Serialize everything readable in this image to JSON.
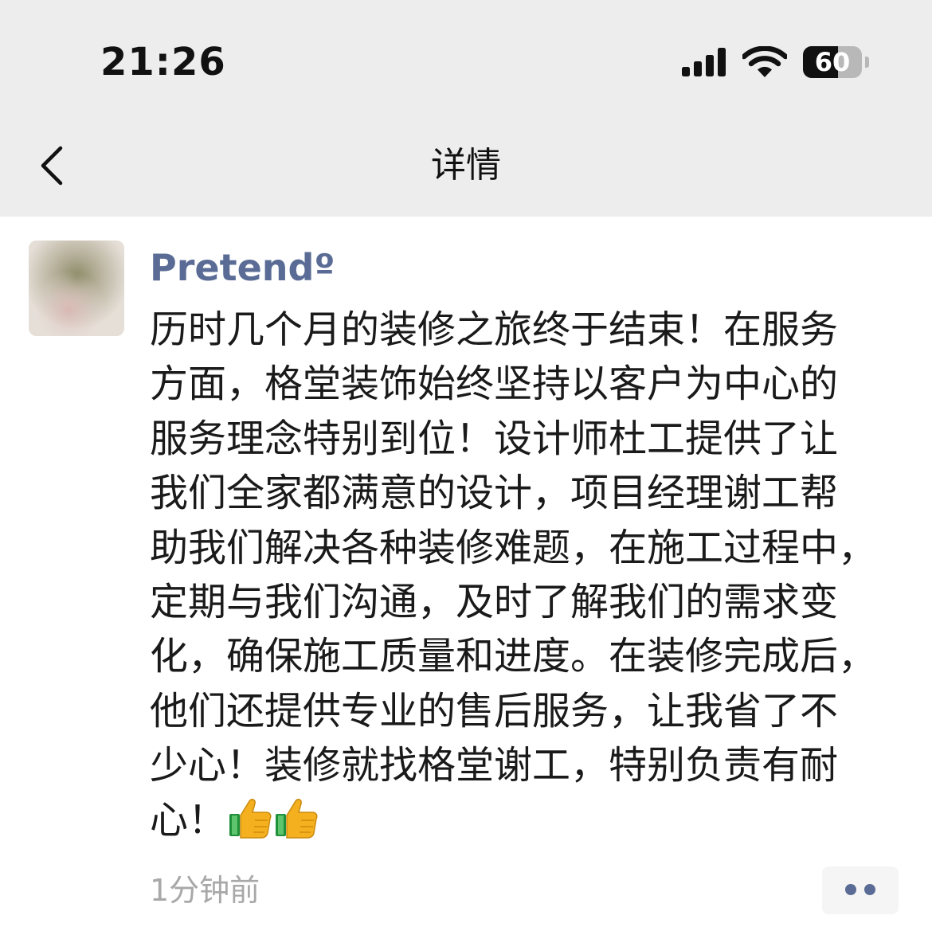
{
  "status_bar": {
    "time": "21:26",
    "battery_level": "60",
    "battery_fraction": 0.6,
    "signal_icon": "cellular-signal-icon",
    "wifi_icon": "wifi-icon"
  },
  "nav": {
    "title": "详情",
    "back_icon": "chevron-left-icon"
  },
  "post": {
    "username": "Pretendº",
    "lines": [
      "历时几个月的装修之旅终于结束！在服务",
      "方面，格堂装饰始终坚持以客户为中心的",
      "服务理念特别到位！设计师杜工提供了让",
      "我们全家都满意的设计，项目经理谢工帮",
      "助我们解决各种装修难题，在施工过程中，",
      "定期与我们沟通，及时了解我们的需求变",
      "化，确保施工质量和进度。在装修完成后，",
      "他们还提供专业的售后服务，让我省了不",
      "少心！装修就找格堂谢工，特别负责有耐",
      "心！"
    ],
    "emojis": [
      "thumbs-up-icon",
      "thumbs-up-icon"
    ],
    "time_ago": "1分钟前",
    "more_icon": "more-dots-icon"
  },
  "colors": {
    "nav_background": "#ededed",
    "username": "#5a6c95",
    "body_text": "#1a1a1a",
    "timestamp": "#a8a8a8",
    "more_dots": "#5a6c95"
  }
}
